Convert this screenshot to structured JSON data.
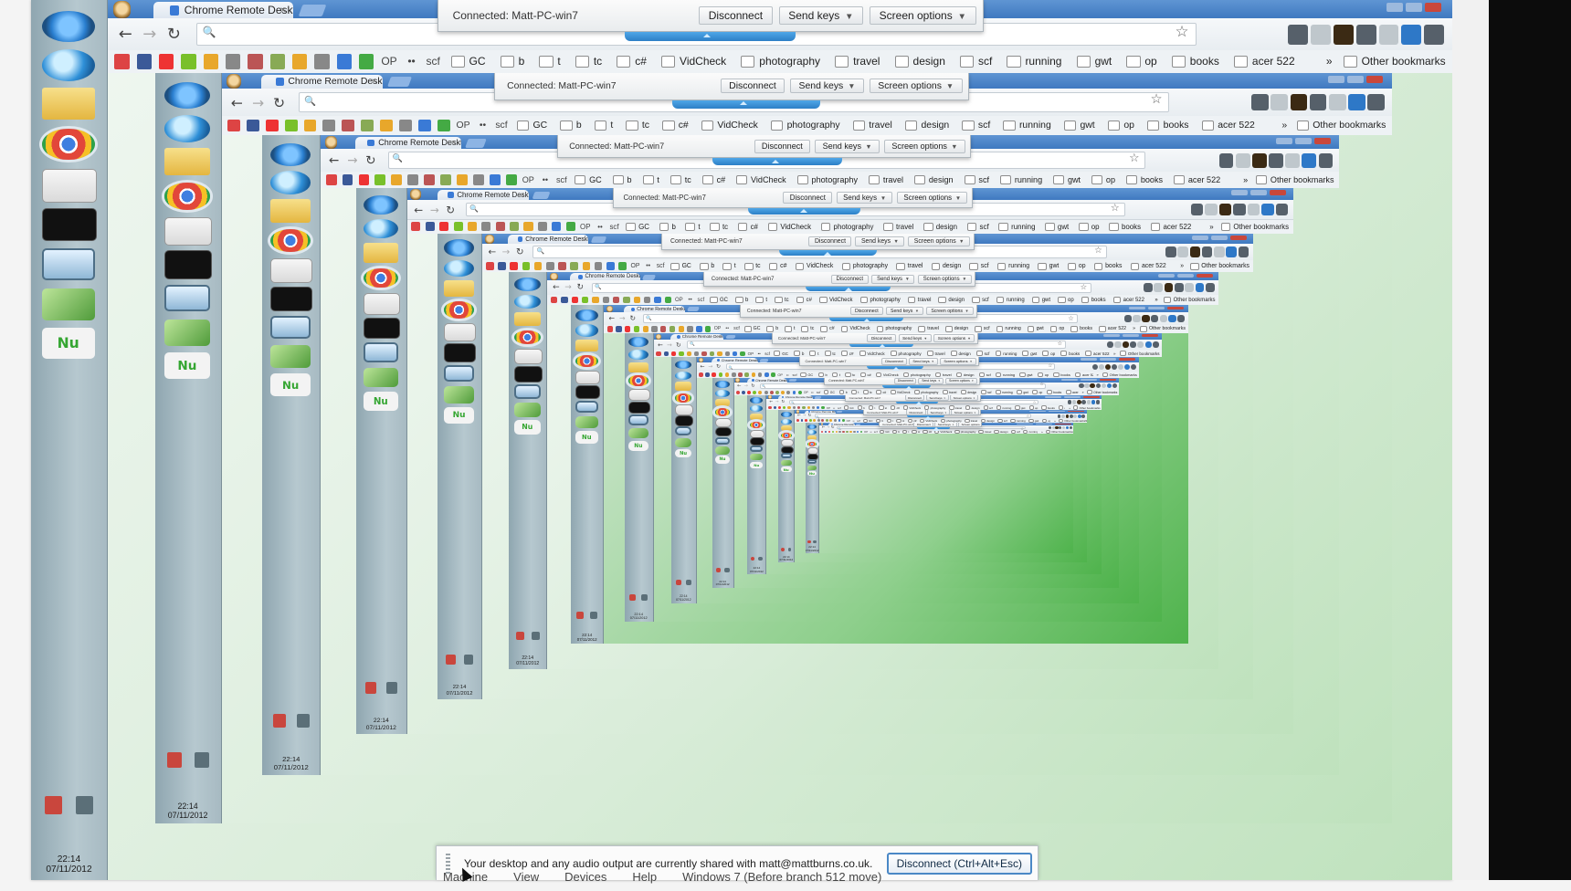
{
  "taskbar": {
    "icons": [
      "start-orb-icon",
      "internet-explorer-icon",
      "folder-icon",
      "chrome-icon",
      "document-icon",
      "command-prompt-icon",
      "remote-desktop-icon",
      "chart-icon",
      "nu-app-icon"
    ],
    "clock": {
      "time": "22:14",
      "date": "07/11/2012"
    }
  },
  "browser": {
    "tab_title": "Chrome Remote Desktop:",
    "tab_close": "×",
    "back_glyph": "←",
    "forward_glyph": "→",
    "reload_glyph": "↻",
    "search_glyph": "🔍",
    "star_glyph": "☆",
    "bookmark_glyphs": [
      "M",
      "f",
      "••",
      "●",
      "●",
      "▣",
      "▣",
      "▣",
      "●",
      "▢",
      "▣",
      "♣"
    ],
    "bookmarks_text": [
      "OP",
      "••",
      "scf"
    ],
    "bookmarks": [
      "GC",
      "b",
      "t",
      "tc",
      "c#",
      "VidCheck",
      "photography",
      "travel",
      "design",
      "scf",
      "running",
      "gwt",
      "op",
      "books",
      "acer 522"
    ],
    "bookmarks_chevron": "»",
    "other_bookmarks": "Other bookmarks"
  },
  "crd": {
    "connected_text": "Connected:  Matt-PC-win7",
    "disconnect": "Disconnect",
    "send_keys": "Send keys",
    "screen_options": "Screen options",
    "caret": "▼"
  },
  "share_bar": {
    "message": "Your desktop and any audio output are currently shared with matt@mattburns.co.uk.",
    "disconnect_button": "Disconnect (Ctrl+Alt+Esc)"
  },
  "guest_menubar": [
    "Machine",
    "View",
    "Devices",
    "Help",
    "Windows 7 (Before branch 512 move)"
  ]
}
